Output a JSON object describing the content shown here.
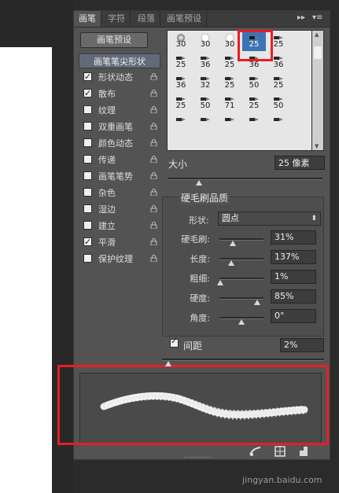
{
  "tabs": [
    {
      "label": "画笔",
      "active": true
    },
    {
      "label": "字符",
      "active": false
    },
    {
      "label": "段落",
      "active": false
    },
    {
      "label": "画笔预设",
      "active": false
    }
  ],
  "tab_controls": {
    "expand": "▸▸",
    "menu": "▾≡"
  },
  "preset_button": "画笔预设",
  "sidebar": {
    "header": "画笔笔尖形状",
    "items": [
      {
        "label": "形状动态",
        "checked": true,
        "lock": true
      },
      {
        "label": "散布",
        "checked": true,
        "lock": true
      },
      {
        "label": "纹理",
        "checked": false,
        "lock": true
      },
      {
        "label": "双重画笔",
        "checked": false,
        "lock": true
      },
      {
        "label": "颜色动态",
        "checked": false,
        "lock": true
      },
      {
        "label": "传递",
        "checked": false,
        "lock": true
      },
      {
        "label": "画笔笔势",
        "checked": false,
        "lock": true
      },
      {
        "label": "杂色",
        "checked": false,
        "lock": true
      },
      {
        "label": "湿边",
        "checked": false,
        "lock": true
      },
      {
        "label": "建立",
        "checked": false,
        "lock": true
      },
      {
        "label": "平滑",
        "checked": true,
        "lock": true
      },
      {
        "label": "保护纹理",
        "checked": false,
        "lock": true
      }
    ]
  },
  "brush_grid": {
    "rows": [
      [
        {
          "n": "30",
          "g": "soft"
        },
        {
          "n": "30",
          "g": "hard"
        },
        {
          "n": "30",
          "g": "hard"
        },
        {
          "n": "25",
          "g": "bristle-selected"
        },
        {
          "n": "25",
          "g": "bristle"
        }
      ],
      [
        {
          "n": "25",
          "g": "bristle"
        },
        {
          "n": "36",
          "g": "bristle"
        },
        {
          "n": "25",
          "g": "bristle"
        },
        {
          "n": "36",
          "g": "bristle"
        },
        {
          "n": "36",
          "g": "bristle"
        }
      ],
      [
        {
          "n": "36",
          "g": "bristle"
        },
        {
          "n": "32",
          "g": "bristle"
        },
        {
          "n": "25",
          "g": "bristle"
        },
        {
          "n": "50",
          "g": "bristle"
        },
        {
          "n": "25",
          "g": "bristle"
        }
      ],
      [
        {
          "n": "25",
          "g": "bristle"
        },
        {
          "n": "50",
          "g": "bristle"
        },
        {
          "n": "71",
          "g": "bristle"
        },
        {
          "n": "25",
          "g": "bristle"
        },
        {
          "n": "50",
          "g": "bristle"
        }
      ],
      [
        {
          "n": "",
          "g": "bristle"
        },
        {
          "n": "",
          "g": "bristle"
        },
        {
          "n": "",
          "g": "bristle"
        },
        {
          "n": "",
          "g": "bristle"
        },
        {
          "n": "",
          "g": "bristle"
        }
      ]
    ]
  },
  "size": {
    "label": "大小",
    "value": "25 像素",
    "slider_fraction": 0.2
  },
  "quality": {
    "title": "硬毛刷品质",
    "shape_label": "形状:",
    "shape_value": "圆点",
    "params": [
      {
        "label": "硬毛刷:",
        "value": "31%",
        "fraction": 0.31
      },
      {
        "label": "长度:",
        "value": "137%",
        "fraction": 0.27
      },
      {
        "label": "粗细:",
        "value": "1%",
        "fraction": 0.01
      },
      {
        "label": "硬度:",
        "value": "85%",
        "fraction": 0.85
      },
      {
        "label": "角度:",
        "value": "0°",
        "fraction": 0.5
      }
    ]
  },
  "spacing": {
    "label": "间距",
    "value": "2%",
    "checked": true,
    "slider_fraction": 0.02
  },
  "watermark": "jingyan.baidu.com",
  "colors": {
    "highlight": "#e81e24",
    "panel": "#535353",
    "tab_bar": "#3c3c3c",
    "header_item": "#616a7a"
  }
}
